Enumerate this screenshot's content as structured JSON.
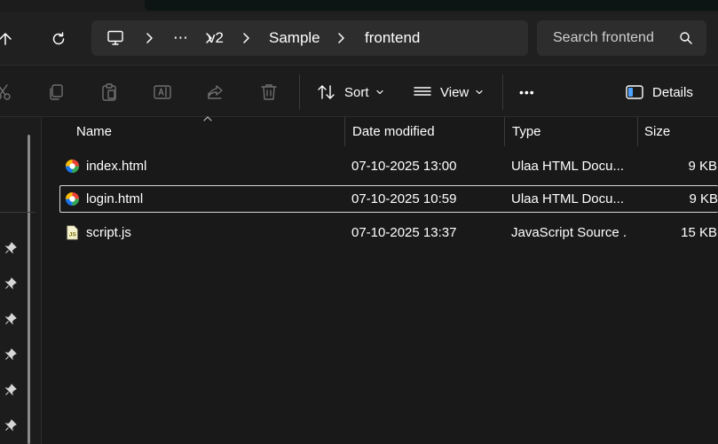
{
  "breadcrumb": {
    "items": [
      "v2",
      "Sample",
      "frontend"
    ],
    "overflow": "⋯"
  },
  "search": {
    "placeholder": "Search frontend"
  },
  "toolbar": {
    "sort_label": "Sort",
    "view_label": "View",
    "more_label": "•••",
    "details_label": "Details"
  },
  "columns": {
    "name": "Name",
    "date": "Date modified",
    "type": "Type",
    "size": "Size"
  },
  "files": [
    {
      "name": "index.html",
      "date": "07-10-2025 13:00",
      "type": "Ulaa HTML Docu...",
      "size": "9 KB",
      "icon": "ulaa-html-icon",
      "selected": false
    },
    {
      "name": "login.html",
      "date": "07-10-2025 10:59",
      "type": "Ulaa HTML Docu...",
      "size": "9 KB",
      "icon": "ulaa-html-icon",
      "selected": true
    },
    {
      "name": "script.js",
      "date": "07-10-2025 13:37",
      "type": "JavaScript Source ...",
      "size": "15 KB",
      "icon": "javascript-file-icon",
      "selected": false
    }
  ],
  "colors": {
    "background": "#191919",
    "chrome": "#202020",
    "field": "#2d2d2d",
    "text": "#ffffff",
    "selection_border": "#d8d8d8"
  }
}
